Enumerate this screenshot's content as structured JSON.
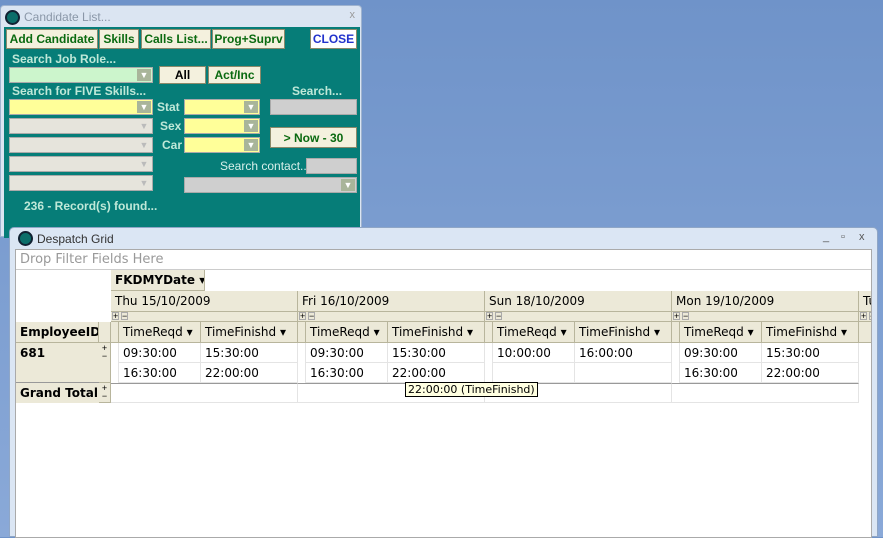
{
  "candidate_window": {
    "title": "Candidate List...",
    "close_glyph": "x",
    "buttons": {
      "add": "Add Candidate",
      "skills": "Skills",
      "calls": "Calls List...",
      "prog": "Prog+Suprv",
      "close": "CLOSE",
      "all": "All",
      "actinc": "Act/Inc",
      "now": "> Now - 30"
    },
    "labels": {
      "job_role": "Search Job Role...",
      "five_skills": "Search for FIVE Skills...",
      "search": "Search...",
      "stat": "Stat",
      "sex": "Sex",
      "car": "Car",
      "search_contact": "Search contact..."
    },
    "records": "236 - Record(s) found..."
  },
  "despatch_window": {
    "title": "Despatch Grid",
    "controls": {
      "min": "_",
      "max": "▫",
      "close": "x"
    },
    "filter_placeholder": "Drop Filter Fields Here",
    "column_field": "FKDMYDate ▾",
    "row_field": "EmployeeID ▾",
    "dates": [
      "Thu 15/10/2009",
      "Fri 16/10/2009",
      "Sun 18/10/2009",
      "Mon 19/10/2009",
      "Tu"
    ],
    "measures": [
      "TimeReqd ▾",
      "TimeFinishd ▾"
    ],
    "rows": [
      {
        "id": "681",
        "values": [
          [
            "09:30:00",
            "15:30:00",
            "16:30:00",
            "22:00:00"
          ],
          [
            "09:30:00",
            "15:30:00",
            "16:30:00",
            "22:00:00"
          ],
          [
            "10:00:00",
            "16:00:00",
            "",
            ""
          ],
          [
            "09:30:00",
            "15:30:00",
            "16:30:00",
            "22:00:00"
          ]
        ]
      }
    ],
    "grand_total": "Grand Total",
    "tooltip": "22:00:00 (TimeFinishd)"
  }
}
